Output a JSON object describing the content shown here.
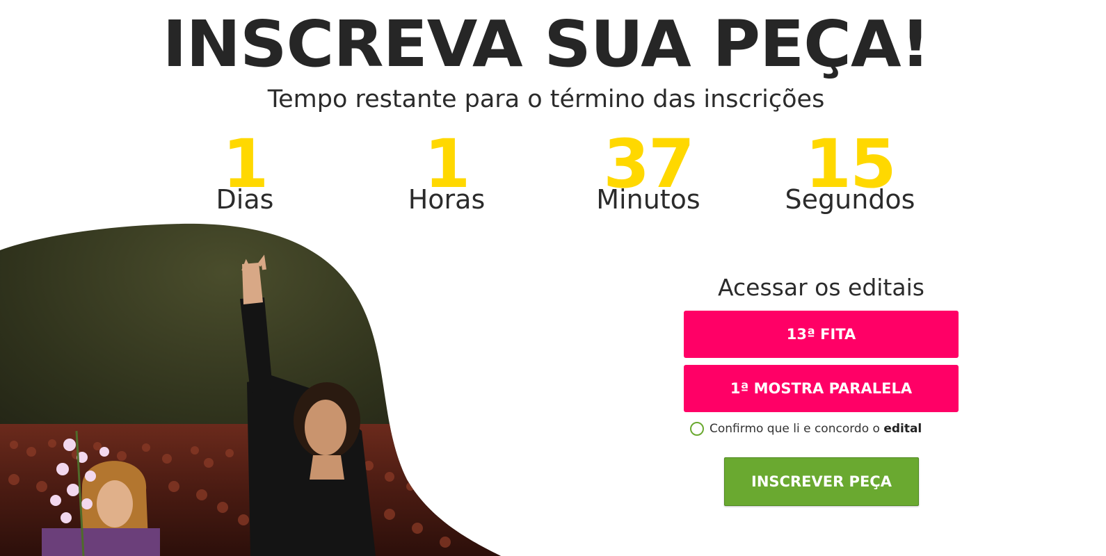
{
  "header": {
    "title": "INSCREVA SUA PEÇA!",
    "subtitle": "Tempo restante para o término das inscrições"
  },
  "countdown": {
    "number_color": "#FFD800",
    "days": {
      "value": "1",
      "label": "Dias"
    },
    "hours": {
      "value": "1",
      "label": "Horas"
    },
    "minutes": {
      "value": "37",
      "label": "Minutos"
    },
    "seconds": {
      "value": "15",
      "label": "Segundos"
    }
  },
  "editais": {
    "heading": "Acessar os editais",
    "button_color": "#FF0066",
    "buttons": [
      {
        "label": "13ª FITA"
      },
      {
        "label": "1ª MOSTRA PARALELA"
      }
    ]
  },
  "confirm": {
    "text": "Confirmo que li e concordo o ",
    "link": "edital"
  },
  "submit": {
    "label": "INSCREVER PEÇA",
    "color": "#6AA930"
  },
  "image": {
    "subject": "stage-performers-photo"
  }
}
